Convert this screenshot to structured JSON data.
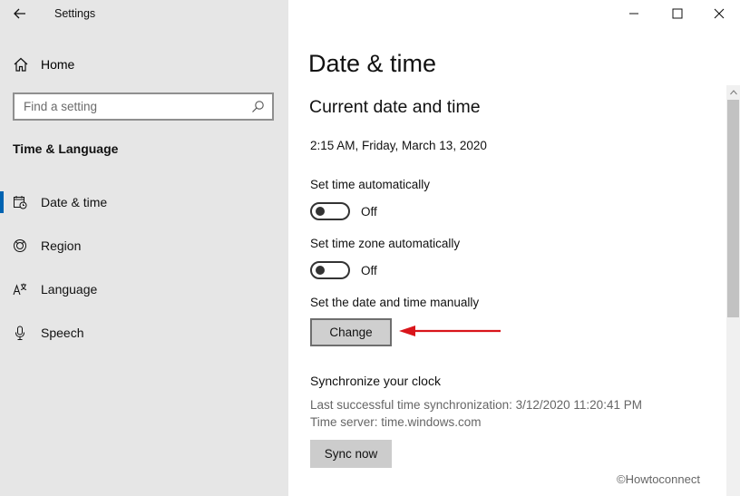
{
  "window": {
    "app_title": "Settings",
    "controls": [
      "minimize",
      "maximize",
      "close"
    ]
  },
  "sidebar": {
    "home_label": "Home",
    "search_placeholder": "Find a setting",
    "section_title": "Time & Language",
    "items": [
      {
        "label": "Date & time",
        "icon": "calendar-clock-icon",
        "active": true
      },
      {
        "label": "Region",
        "icon": "globe-icon",
        "active": false
      },
      {
        "label": "Language",
        "icon": "language-icon",
        "active": false
      },
      {
        "label": "Speech",
        "icon": "microphone-icon",
        "active": false
      }
    ]
  },
  "main": {
    "page_title": "Date & time",
    "sub_title": "Current date and time",
    "current_time": "2:15 AM, Friday, March 13, 2020",
    "set_time_auto": {
      "label": "Set time automatically",
      "state": "Off"
    },
    "set_timezone_auto": {
      "label": "Set time zone automatically",
      "state": "Off"
    },
    "manual": {
      "label": "Set the date and time manually",
      "button": "Change"
    },
    "sync": {
      "title": "Synchronize your clock",
      "last_sync": "Last successful time synchronization: 3/12/2020 11:20:41 PM",
      "server": "Time server: time.windows.com",
      "button": "Sync now"
    },
    "watermark": "©Howtoconnect"
  },
  "colors": {
    "accent": "#0063b1",
    "annotation_arrow": "#d9151b",
    "sidebar_bg": "#e6e6e6"
  }
}
